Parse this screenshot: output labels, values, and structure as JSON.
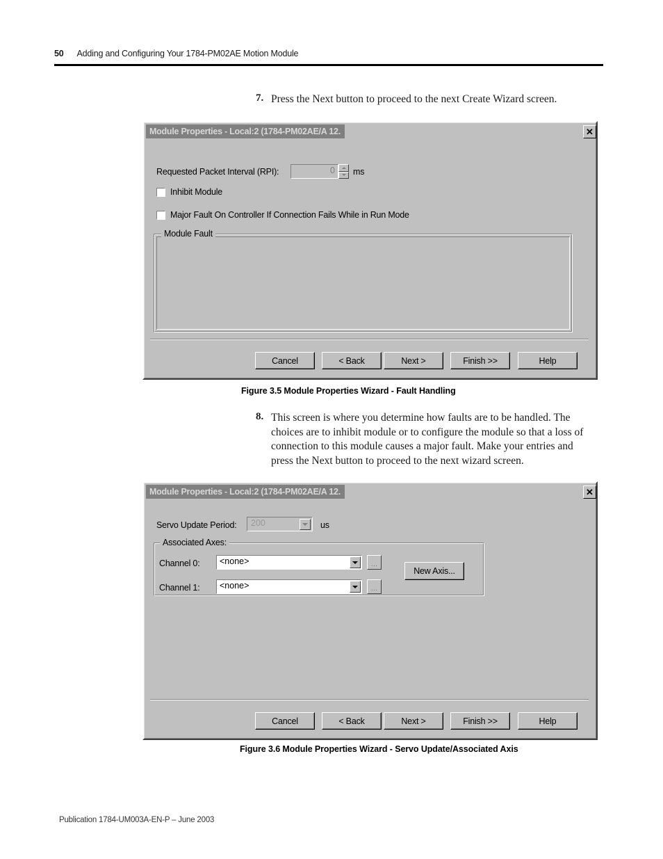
{
  "page": {
    "number": "50",
    "header_title": "Adding and Configuring Your 1784-PM02AE Motion Module",
    "footer": "Publication 1784-UM003A-EN-P – June 2003"
  },
  "steps": [
    {
      "num": "7.",
      "text": "Press the Next button to proceed to the next Create Wizard screen."
    },
    {
      "num": "8.",
      "text": "This screen is where you determine how faults are to be handled. The choices are to inhibit module or to configure the module so that a loss of connection to this module causes a major fault. Make your entries and press the Next button to proceed to the next wizard screen."
    }
  ],
  "dialog_fault": {
    "title": "Module Properties - Local:2 (1784-PM02AE/A 12.",
    "close_label": "✕",
    "rpi_label": "Requested Packet Interval (RPI):",
    "rpi_value": "0",
    "rpi_units": "ms",
    "inhibit_label": "Inhibit Module",
    "major_fault_label": "Major Fault On Controller If Connection Fails While in Run Mode",
    "module_fault_group": "Module Fault",
    "module_fault_text": "",
    "buttons": {
      "cancel": "Cancel",
      "back": "< Back",
      "next": "Next >",
      "finish": "Finish >>",
      "help": "Help"
    }
  },
  "caption_35": "Figure 3.5 Module Properties Wizard - Fault Handling",
  "dialog_servo": {
    "title": "Module Properties - Local:2 (1784-PM02AE/A 12.",
    "close_label": "✕",
    "servo_label": "Servo Update Period:",
    "servo_value": "200",
    "servo_units": "us",
    "axes_group": "Associated Axes:",
    "channel0_label": "Channel 0:",
    "channel0_value": "<none>",
    "channel1_label": "Channel 1:",
    "channel1_value": "<none>",
    "browse_label": "...",
    "new_axis_label": "New Axis...",
    "buttons": {
      "cancel": "Cancel",
      "back": "< Back",
      "next": "Next >",
      "finish": "Finish >>",
      "help": "Help"
    }
  },
  "caption_36": "Figure 3.6 Module Properties Wizard - Servo Update/Associated Axis"
}
